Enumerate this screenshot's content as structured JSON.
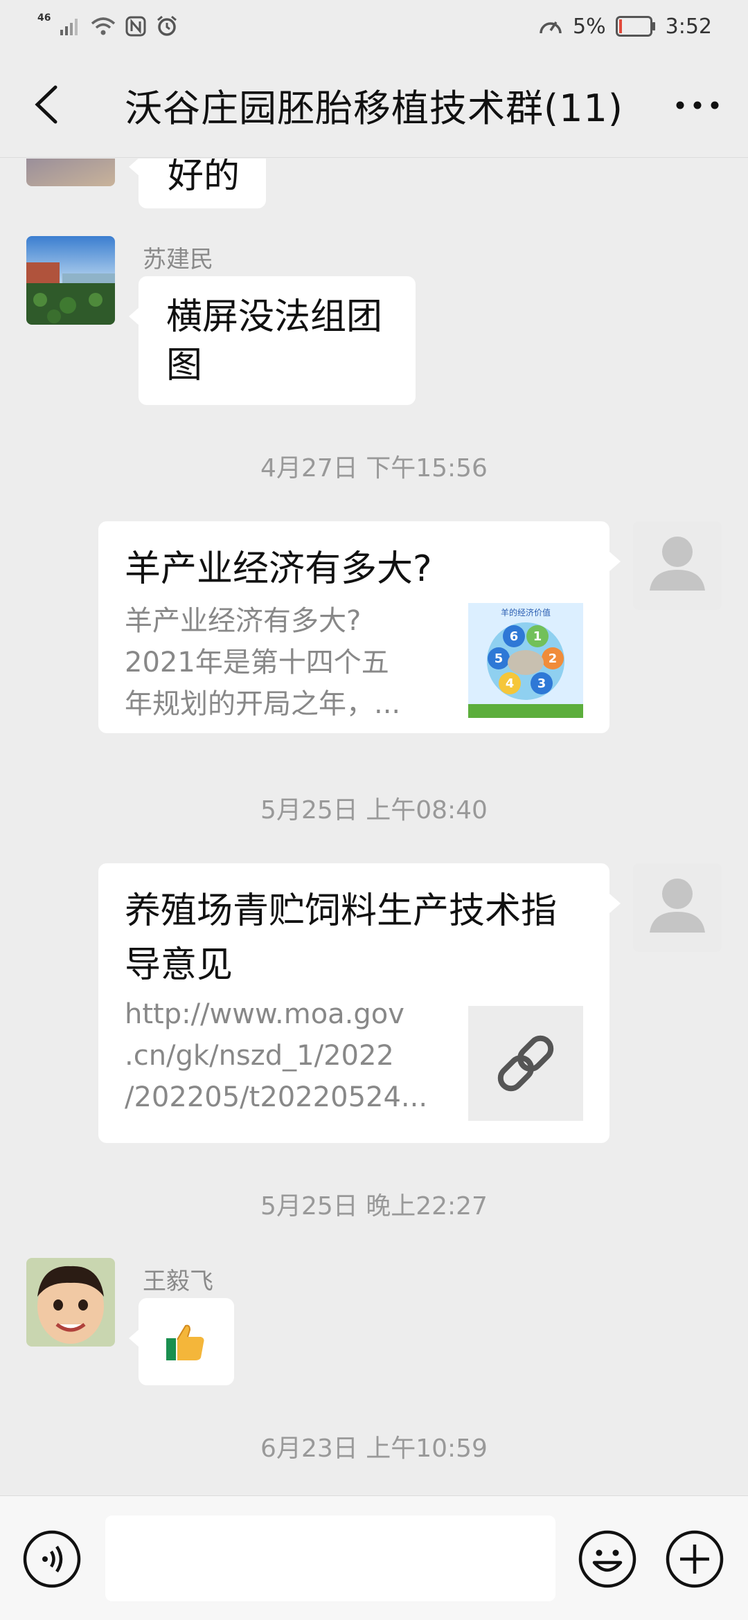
{
  "status_bar": {
    "network": "46",
    "battery_percent": "5%",
    "time": "3:52",
    "accent_battery_low": "#E24A3B"
  },
  "header": {
    "title": "沃谷庄园胚胎移植技术群(11)"
  },
  "messages": {
    "m0": {
      "text": "好的"
    },
    "m1": {
      "sender": "苏建民",
      "text_line1": "横屏没法组团",
      "text_line2": "图"
    },
    "ts1": "4月27日 下午15:56",
    "card1": {
      "title": "羊产业经济有多大?",
      "desc_line1": "羊产业经济有多大?",
      "desc_line2": "2021年是第十四个五",
      "desc_line3": "年规划的开局之年，...",
      "thumb_title": "羊的经济价值",
      "thumb_numbers": [
        "1",
        "2",
        "3",
        "4",
        "5",
        "6"
      ]
    },
    "ts2": "5月25日 上午08:40",
    "card2": {
      "title_line1": "养殖场青贮饲料生产技术指",
      "title_line2": "导意见",
      "desc_line1": "http://www.moa.gov",
      "desc_line2": ".cn/gk/nszd_1/2022",
      "desc_line3": "/202205/t20220524...",
      "thumb_icon": "link-icon"
    },
    "ts3": "5月25日 晚上22:27",
    "m4": {
      "sender": "王毅飞",
      "emoji": "👍",
      "emoji_icon": "thumbs-up-icon"
    },
    "ts4": "6月23日 上午10:59"
  },
  "input_bar": {
    "voice_icon": "voice-icon",
    "emoji_icon": "smiley-icon",
    "plus_icon": "plus-icon",
    "text_value": ""
  }
}
